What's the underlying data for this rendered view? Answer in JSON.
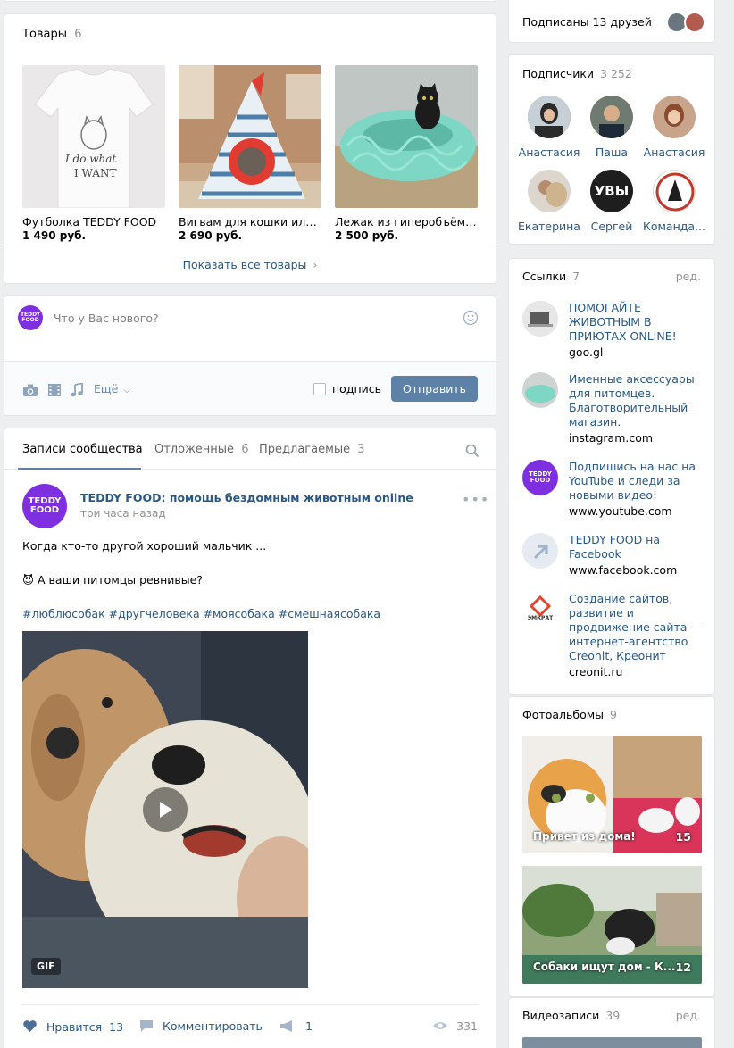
{
  "goods": {
    "title": "Товары",
    "count": "6",
    "items": [
      {
        "name": "Футболка TEDDY FOOD",
        "price": "1 490 руб.",
        "shirt_text_1": "I do what",
        "shirt_text_2": "I WANT"
      },
      {
        "name": "Вигвам для кошки или с...",
        "price": "2 690 руб."
      },
      {
        "name": "Лежак из гиперобъёмн...",
        "price": "2 500 руб."
      }
    ],
    "show_all": "Показать все товары"
  },
  "composer": {
    "avatar_text": "TEDDY FOOD",
    "placeholder": "Что у Вас нового?",
    "more_label": "Ещё",
    "signature_label": "подпись",
    "send_label": "Отправить"
  },
  "tabs": [
    {
      "label": "Записи сообщества",
      "count": ""
    },
    {
      "label": "Отложенные",
      "count": "6"
    },
    {
      "label": "Предлагаемые",
      "count": "3"
    }
  ],
  "post": {
    "author": "TEDDY FOOD: помощь бездомным животным online",
    "time": "три часа назад",
    "line1": "Когда кто-то другой хороший мальчик ...",
    "line2_emoji": "😈",
    "line2": "А ваши питомцы ревнивые?",
    "hashtags": "#люблюсобак #другчеловека #моясобака #смешнаясобака",
    "media_badge": "GIF",
    "like_label": "Нравится",
    "like_count": "13",
    "comment_label": "Комментировать",
    "share_count": "1",
    "views": "331"
  },
  "subscribed_friends": {
    "label": "Подписаны 13 друзей"
  },
  "followers": {
    "title": "Подписчики",
    "count": "3 252",
    "people": [
      {
        "name": "Анастасия"
      },
      {
        "name": "Паша"
      },
      {
        "name": "Анастасия"
      },
      {
        "name": "Екатерина"
      },
      {
        "name": "Сергей",
        "avatar_text": "УВЫ"
      },
      {
        "name": "Команда..."
      }
    ]
  },
  "links": {
    "title": "Ссылки",
    "count": "7",
    "edit": "ред.",
    "items": [
      {
        "title": "ПОМОГАЙТЕ ЖИВОТНЫМ В ПРИЮТАХ ONLINE!",
        "host": "goo.gl"
      },
      {
        "title": "Именные аксессуары для питомцев. Благотворительный магазин.",
        "host": "instagram.com"
      },
      {
        "title": "Подпишись на нас на YouTube и следи за новыми видео!",
        "host": "www.youtube.com",
        "icon_text": "TEDDY FOOD"
      },
      {
        "title": "TEDDY FOOD на Facebook",
        "host": "www.facebook.com"
      },
      {
        "title": "Создание сайтов, развитие и продвижение сайта — интернет-агентство Creonit, Креонит",
        "host": "creonit.ru",
        "icon_text": "ЭМКРАТ"
      }
    ]
  },
  "albums": {
    "title": "Фотоальбомы",
    "count": "9",
    "items": [
      {
        "name": "Привет из дома!",
        "count": "15"
      },
      {
        "name": "Собаки ищут дом - К...",
        "count": "12"
      }
    ]
  },
  "videos": {
    "title": "Видеозаписи",
    "count": "39",
    "edit": "ред."
  },
  "colors": {
    "accent": "#5e81a8",
    "link": "#2a5885",
    "brand": "#7e2fe0",
    "background": "#edeef0"
  }
}
